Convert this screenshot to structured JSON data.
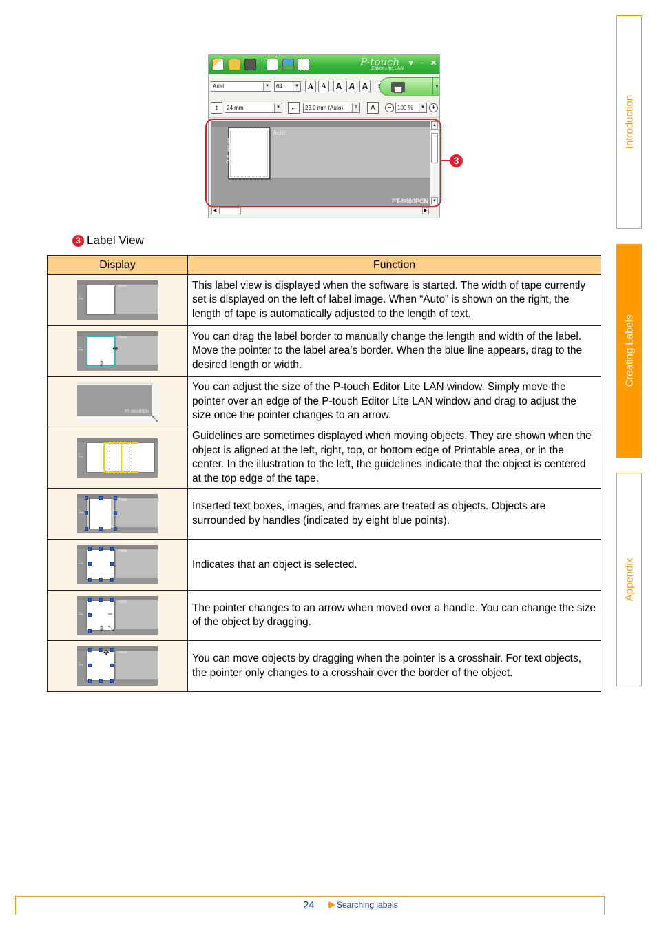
{
  "app_window": {
    "brand": "P-touch",
    "brand_sub": "Editor Lite LAN",
    "minimize": "_",
    "close": "✕",
    "menu_arrow": "▾",
    "toolbar_icons": [
      "new-label-icon",
      "open-icon",
      "save-icon",
      "insert-text-icon",
      "insert-image-icon",
      "insert-frame-icon"
    ],
    "font_name": "Arial",
    "font_size": "64",
    "font_buttons": [
      "A",
      "A",
      "A",
      "A",
      "A"
    ],
    "tape_width": "24 mm",
    "label_length": "23.0 mm (Auto)",
    "zoom_level": "100 %",
    "canvas": {
      "tape_width_label": "24 mm",
      "auto_label": "Auto",
      "printer_model": "PT-9800PCN"
    },
    "callout_number": "3"
  },
  "section": {
    "number": "3",
    "title": "Label View"
  },
  "table": {
    "headers": {
      "display": "Display",
      "function": "Function"
    },
    "rows": [
      {
        "thumb": {
          "auto": "Auto",
          "tape": "1\""
        },
        "text": "This label view is displayed when the software is started. The width of tape currently set is displayed on the left of label image. When “Auto” is shown on the right, the length of tape is automatically adjusted to the length of text."
      },
      {
        "thumb": {
          "auto": "Auto",
          "tape": "1\""
        },
        "text": "You can drag the label border to manually change the length and width of the label. Move the pointer to the label area’s border. When the blue line appears, drag to the desired length or width."
      },
      {
        "thumb": {
          "model": "PT-9800PCN"
        },
        "text": "You can adjust the size of the P-touch Editor Lite LAN window. Simply move the pointer over an edge of the P-touch Editor Lite LAN window and drag to adjust the size once the pointer changes to an arrow."
      },
      {
        "thumb": {
          "tape": "1\""
        },
        "text": "Guidelines are sometimes displayed when moving objects. They are shown when the object is aligned at the left, right, top, or bottom edge of Printable area, or in the center. In the illustration to the left, the guidelines indicate that the object is centered at the top edge of the tape."
      },
      {
        "thumb": {
          "auto": "Auto",
          "tape": "1\""
        },
        "text": "Inserted text boxes, images, and frames are treated as objects. Objects are surrounded by handles (indicated by eight blue points)."
      },
      {
        "thumb": {
          "auto": "Auto",
          "tape": "1\""
        },
        "text": "Indicates that an object is selected."
      },
      {
        "thumb": {
          "auto": "Auto",
          "tape": "1\""
        },
        "text": "The pointer changes to an arrow when moved over a handle. You can change the size of the object by dragging."
      },
      {
        "thumb": {
          "auto": "Auto",
          "tape": "1\""
        },
        "text": "You can move objects by dragging when the pointer is a crosshair. For text objects, the pointer only changes to a crosshair over the border of the object."
      }
    ]
  },
  "side_tabs": [
    {
      "label": "Introduction",
      "active": false
    },
    {
      "label": "Creating Labels",
      "active": true
    },
    {
      "label": "Appendix",
      "active": false
    }
  ],
  "footer": {
    "page_number": "24",
    "link_label": "Searching labels"
  },
  "colors": {
    "accent_orange": "#ff9a00",
    "callout_red": "#e0212b",
    "header_fill": "#fdd08a",
    "link_blue": "#1f3b8c"
  }
}
